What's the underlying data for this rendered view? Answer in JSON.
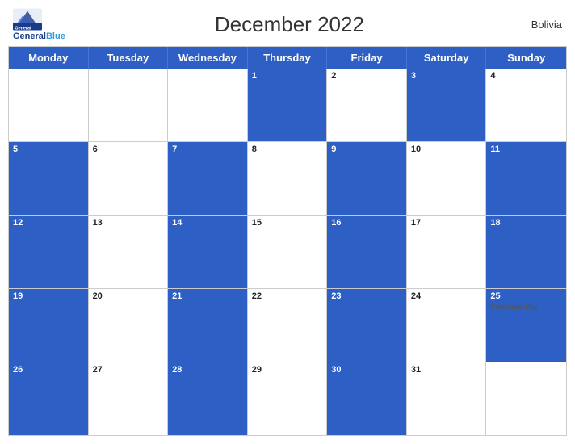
{
  "header": {
    "logo_line1": "General",
    "logo_line2": "Blue",
    "title": "December 2022",
    "country": "Bolivia"
  },
  "days": [
    "Monday",
    "Tuesday",
    "Wednesday",
    "Thursday",
    "Friday",
    "Saturday",
    "Sunday"
  ],
  "weeks": [
    [
      {
        "date": "",
        "blue": false,
        "event": ""
      },
      {
        "date": "",
        "blue": false,
        "event": ""
      },
      {
        "date": "",
        "blue": false,
        "event": ""
      },
      {
        "date": "1",
        "blue": true,
        "event": ""
      },
      {
        "date": "2",
        "blue": false,
        "event": ""
      },
      {
        "date": "3",
        "blue": true,
        "event": ""
      },
      {
        "date": "4",
        "blue": false,
        "event": ""
      }
    ],
    [
      {
        "date": "5",
        "blue": true,
        "event": ""
      },
      {
        "date": "6",
        "blue": false,
        "event": ""
      },
      {
        "date": "7",
        "blue": true,
        "event": ""
      },
      {
        "date": "8",
        "blue": false,
        "event": ""
      },
      {
        "date": "9",
        "blue": true,
        "event": ""
      },
      {
        "date": "10",
        "blue": false,
        "event": ""
      },
      {
        "date": "11",
        "blue": true,
        "event": ""
      }
    ],
    [
      {
        "date": "12",
        "blue": true,
        "event": ""
      },
      {
        "date": "13",
        "blue": false,
        "event": ""
      },
      {
        "date": "14",
        "blue": true,
        "event": ""
      },
      {
        "date": "15",
        "blue": false,
        "event": ""
      },
      {
        "date": "16",
        "blue": true,
        "event": ""
      },
      {
        "date": "17",
        "blue": false,
        "event": ""
      },
      {
        "date": "18",
        "blue": true,
        "event": ""
      }
    ],
    [
      {
        "date": "19",
        "blue": true,
        "event": ""
      },
      {
        "date": "20",
        "blue": false,
        "event": ""
      },
      {
        "date": "21",
        "blue": true,
        "event": ""
      },
      {
        "date": "22",
        "blue": false,
        "event": ""
      },
      {
        "date": "23",
        "blue": true,
        "event": ""
      },
      {
        "date": "24",
        "blue": false,
        "event": ""
      },
      {
        "date": "25",
        "blue": true,
        "event": "Christmas Day"
      }
    ],
    [
      {
        "date": "26",
        "blue": true,
        "event": ""
      },
      {
        "date": "27",
        "blue": false,
        "event": ""
      },
      {
        "date": "28",
        "blue": true,
        "event": ""
      },
      {
        "date": "29",
        "blue": false,
        "event": ""
      },
      {
        "date": "30",
        "blue": true,
        "event": ""
      },
      {
        "date": "31",
        "blue": false,
        "event": ""
      },
      {
        "date": "",
        "blue": false,
        "event": ""
      }
    ]
  ]
}
